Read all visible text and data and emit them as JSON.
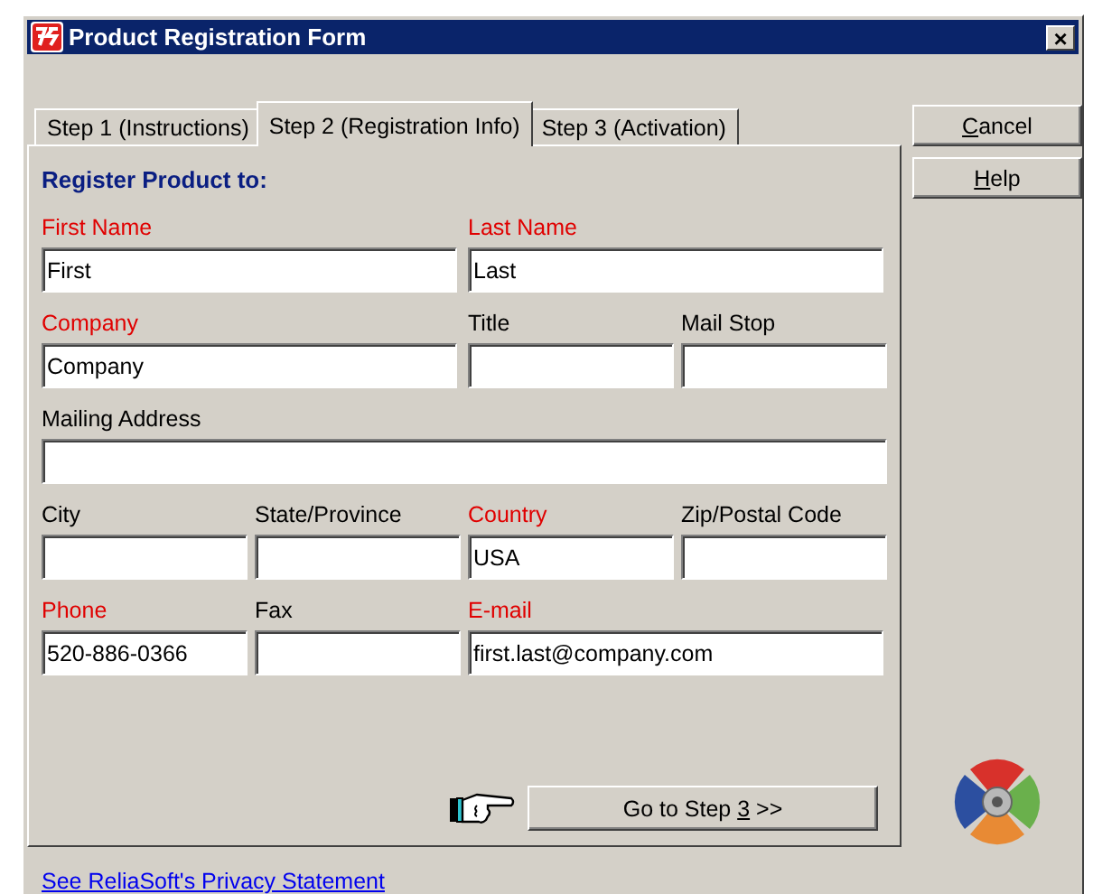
{
  "window": {
    "title": "Product Registration Form",
    "close": "×"
  },
  "tabs": [
    {
      "label": "Step 1 (Instructions)",
      "selected": false
    },
    {
      "label": "Step 2 (Registration Info)",
      "selected": true
    },
    {
      "label": "Step 3 (Activation)",
      "selected": false
    }
  ],
  "heading": "Register Product to:",
  "rows": [
    [
      {
        "label": "First Name",
        "required": true,
        "value": "First",
        "kind": "wide"
      },
      {
        "label": "Last Name",
        "required": true,
        "value": "Last",
        "kind": "wide"
      }
    ],
    [
      {
        "label": "Company",
        "required": true,
        "value": "Company",
        "kind": "wide"
      },
      {
        "label": "Title",
        "required": false,
        "kind": "narrow"
      },
      {
        "label": "Mail Stop",
        "required": false,
        "kind": "narrow"
      }
    ],
    [
      {
        "label": "Mailing Address",
        "required": false,
        "kind": "full"
      }
    ],
    [
      {
        "label": "City",
        "required": false,
        "kind": "narrow"
      },
      {
        "label": "State/Province",
        "required": false,
        "kind": "narrow"
      },
      {
        "label": "Country",
        "required": true,
        "value": "USA",
        "kind": "narrow"
      },
      {
        "label": "Zip/Postal Code",
        "required": false,
        "kind": "narrow"
      }
    ],
    [
      {
        "label": "Phone",
        "required": true,
        "value": "520-886-0366",
        "kind": "narrow"
      },
      {
        "label": "Fax",
        "required": false,
        "kind": "narrow"
      },
      {
        "label": "E-mail",
        "required": true,
        "value": "first.last@company.com",
        "kind": "wide"
      }
    ]
  ],
  "next_button": {
    "before": "Go to Step ",
    "key": "3",
    "after": " >>"
  },
  "side_buttons": [
    {
      "key": "C",
      "after": "ancel"
    },
    {
      "key": "H",
      "after": "elp"
    }
  ],
  "privacy_link": "See ReliaSoft's Privacy Statement"
}
